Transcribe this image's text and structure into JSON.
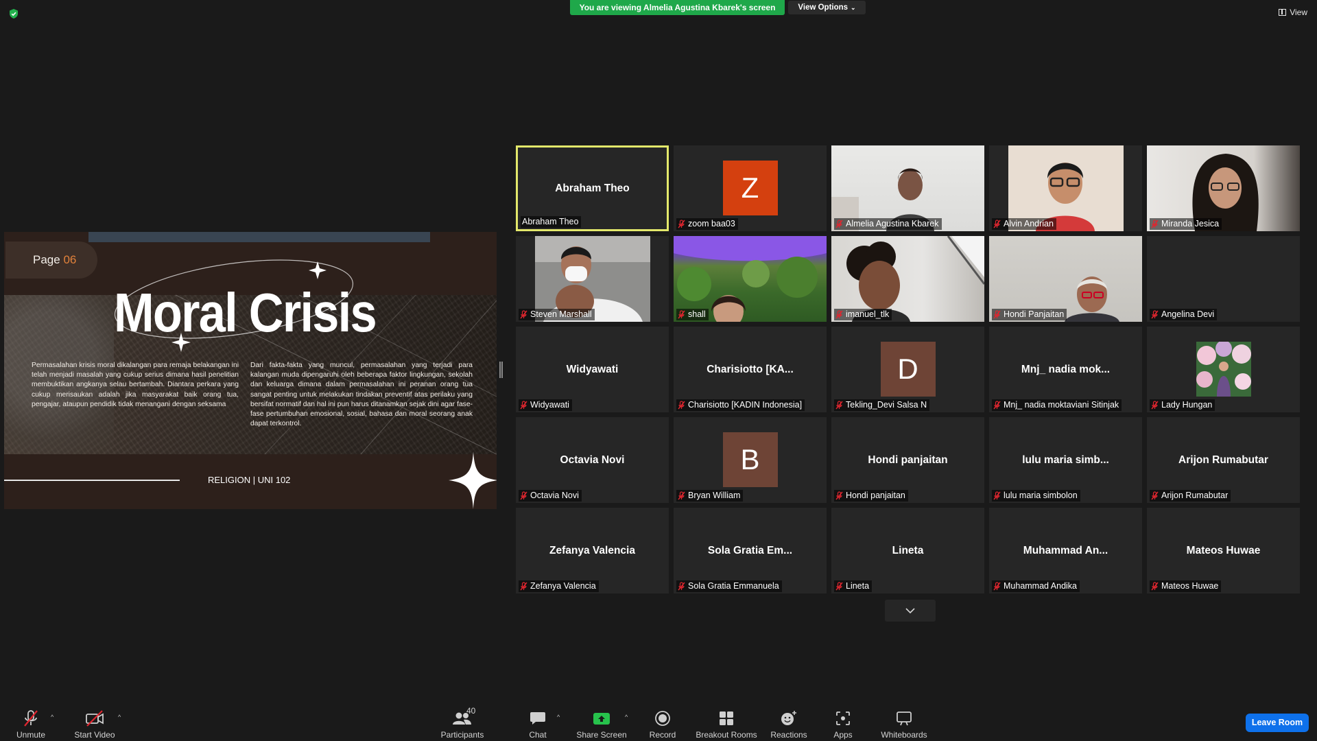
{
  "top": {
    "banner": "You are viewing Almelia Agustina Kbarek's screen",
    "view_options": "View Options",
    "view": "View"
  },
  "slide": {
    "page_label": "Page",
    "page_number": "06",
    "title": "Moral Crisis",
    "left_text": "Permasalahan krisis moral dikalangan para remaja belakangan ini telah menjadi masalah yang cukup serius dimana hasil penelitian membuktikan angkanya selau bertambah. Diantara perkara yang cukup merisaukan adalah jika masyarakat baik orang tua, pengajar, ataupun pendidik tidak menangani dengan seksama",
    "right_text": "Dari fakta-fakta yang muncul, permasalahan yang terjadi para kalangan muda dipengaruhi oleh beberapa faktor lingkungan, sekolah dan keluarga dimana dalam permasalahan ini peranan orang tua sangat penting untuk melakukan tindakan preventif atas perilaku yang bersifat normatif dan hal ini pun harus ditanamkan sejak dini agar fase-fase pertumbuhan emosional, sosial, bahasa dan moral seorang anak dapat terkontrol.",
    "footer": "RELIGION | UNI 102"
  },
  "participants": [
    {
      "name": "Abraham Theo",
      "display": "Abraham Theo",
      "kind": "name",
      "active": true
    },
    {
      "name": "zoom baa03",
      "display": "Z",
      "kind": "letter",
      "color": "#d4400f"
    },
    {
      "name": "Almelia Agustina Kbarek",
      "kind": "video",
      "video": "almelia"
    },
    {
      "name": "Alvin Andrian",
      "kind": "video",
      "video": "alvin"
    },
    {
      "name": "Miranda Jesica",
      "kind": "video",
      "video": "miranda"
    },
    {
      "name": "Steven Marshall",
      "kind": "video",
      "video": "steven"
    },
    {
      "name": "shall",
      "kind": "video",
      "video": "shall"
    },
    {
      "name": "imanuel_tlk",
      "kind": "video",
      "video": "imanuel"
    },
    {
      "name": "Hondi Panjaitan",
      "kind": "video",
      "video": "hondi"
    },
    {
      "name": "Angelina Devi",
      "kind": "blank"
    },
    {
      "name": "Widyawati",
      "display": "Widyawati",
      "kind": "name"
    },
    {
      "name": "Charisiotto [KADIN Indonesia]",
      "display": "Charisiotto [KA...",
      "kind": "name"
    },
    {
      "name": "Tekling_Devi Salsa N",
      "display": "D",
      "kind": "letter",
      "color": "#6e4436"
    },
    {
      "name": "Mnj_ nadia moktaviani Sitinjak",
      "display": "Mnj_ nadia mok...",
      "kind": "name"
    },
    {
      "name": "Lady Hungan",
      "kind": "image"
    },
    {
      "name": "Octavia Novi",
      "display": "Octavia Novi",
      "kind": "name"
    },
    {
      "name": "Bryan William",
      "display": "B",
      "kind": "letter",
      "color": "#6e4436"
    },
    {
      "name": "Hondi panjaitan",
      "display": "Hondi panjaitan",
      "kind": "name"
    },
    {
      "name": "lulu maria simbolon",
      "display": "lulu maria simb...",
      "kind": "name"
    },
    {
      "name": "Arijon Rumabutar",
      "display": "Arijon Rumabutar",
      "kind": "name"
    },
    {
      "name": "Zefanya Valencia",
      "display": "Zefanya Valencia",
      "kind": "name"
    },
    {
      "name": "Sola Gratia Emmanuela",
      "display": "Sola Gratia Em...",
      "kind": "name"
    },
    {
      "name": "Lineta",
      "display": "Lineta",
      "kind": "name"
    },
    {
      "name": "Muhammad Andika",
      "display": "Muhammad An...",
      "kind": "name"
    },
    {
      "name": "Mateos Huwae",
      "display": "Mateos Huwae",
      "kind": "name"
    }
  ],
  "toolbar": {
    "unmute": "Unmute",
    "start_video": "Start Video",
    "participants": "Participants",
    "participants_count": "40",
    "chat": "Chat",
    "share_screen": "Share Screen",
    "record": "Record",
    "breakout_rooms": "Breakout Rooms",
    "reactions": "Reactions",
    "apps": "Apps",
    "whiteboards": "Whiteboards",
    "leave_room": "Leave Room"
  },
  "colors": {
    "banner_green": "#1fa84a",
    "active_speaker": "#e3e86b",
    "leave_blue": "#0e71eb",
    "share_green": "#27c24c",
    "muted_red": "#e0262f"
  }
}
